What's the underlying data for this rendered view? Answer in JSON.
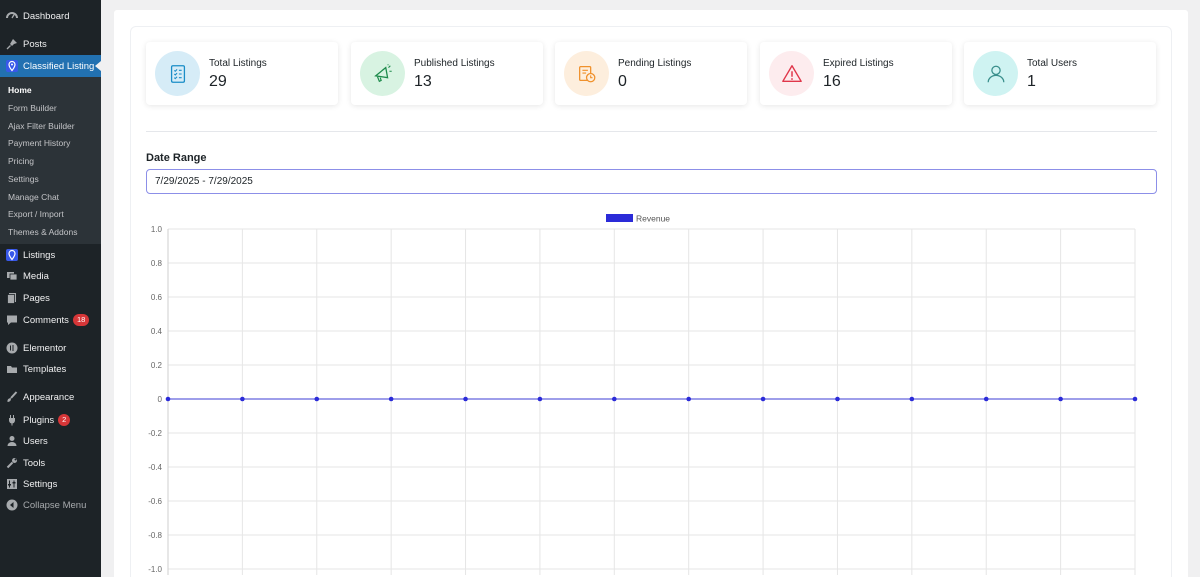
{
  "sidebar": {
    "items": [
      {
        "label": "Dashboard",
        "icon": "dashboard-icon"
      },
      {
        "label": "Posts",
        "icon": "pin-icon"
      },
      {
        "label": "Classified Listing",
        "icon": "location-pin-icon"
      },
      {
        "label": "Listings",
        "icon": "location-pin-icon"
      },
      {
        "label": "Media",
        "icon": "media-icon"
      },
      {
        "label": "Pages",
        "icon": "pages-icon"
      },
      {
        "label": "Comments",
        "icon": "comments-icon",
        "badge": "18"
      },
      {
        "label": "Elementor",
        "icon": "elementor-icon"
      },
      {
        "label": "Templates",
        "icon": "folder-icon"
      },
      {
        "label": "Appearance",
        "icon": "brush-icon"
      },
      {
        "label": "Plugins",
        "icon": "plug-icon",
        "badge": "2"
      },
      {
        "label": "Users",
        "icon": "user-icon"
      },
      {
        "label": "Tools",
        "icon": "wrench-icon"
      },
      {
        "label": "Settings",
        "icon": "sliders-icon"
      },
      {
        "label": "Collapse Menu",
        "icon": "collapse-icon"
      }
    ],
    "submenu": [
      "Home",
      "Form Builder",
      "Ajax Filter Builder",
      "Payment History",
      "Pricing",
      "Settings",
      "Manage Chat",
      "Export / Import",
      "Themes & Addons"
    ]
  },
  "stats": [
    {
      "label": "Total Listings",
      "value": "29",
      "icon": "checklist-icon",
      "bg": "#d6ecf7",
      "color": "#1a8dc7"
    },
    {
      "label": "Published Listings",
      "value": "13",
      "icon": "megaphone-icon",
      "bg": "#d8f3e2",
      "color": "#1c8a4a"
    },
    {
      "label": "Pending Listings",
      "value": "0",
      "icon": "pending-clock-icon",
      "bg": "#fdeedd",
      "color": "#f0912c"
    },
    {
      "label": "Expired Listings",
      "value": "16",
      "icon": "warning-icon",
      "bg": "#fdecee",
      "color": "#e0364a"
    },
    {
      "label": "Total Users",
      "value": "1",
      "icon": "user-icon",
      "bg": "#cff3f2",
      "color": "#3a8f8c"
    }
  ],
  "date_range": {
    "label": "Date Range",
    "value": "7/29/2025 - 7/29/2025"
  },
  "colors": {
    "accent": "#2271b1",
    "series": "#2b2bd8"
  },
  "chart_data": {
    "type": "line",
    "series": [
      {
        "name": "Revenue",
        "values": [
          0,
          0,
          0,
          0,
          0,
          0,
          0,
          0,
          0,
          0,
          0,
          0,
          0,
          0
        ]
      }
    ],
    "ylim": [
      -1.0,
      1.0
    ],
    "yticks": [
      "1.0",
      "0.8",
      "0.6",
      "0.4",
      "0.2",
      "0",
      "-0.2",
      "-0.4",
      "-0.6",
      "-0.8",
      "-1.0"
    ],
    "grid": true,
    "legend": "top-center"
  }
}
